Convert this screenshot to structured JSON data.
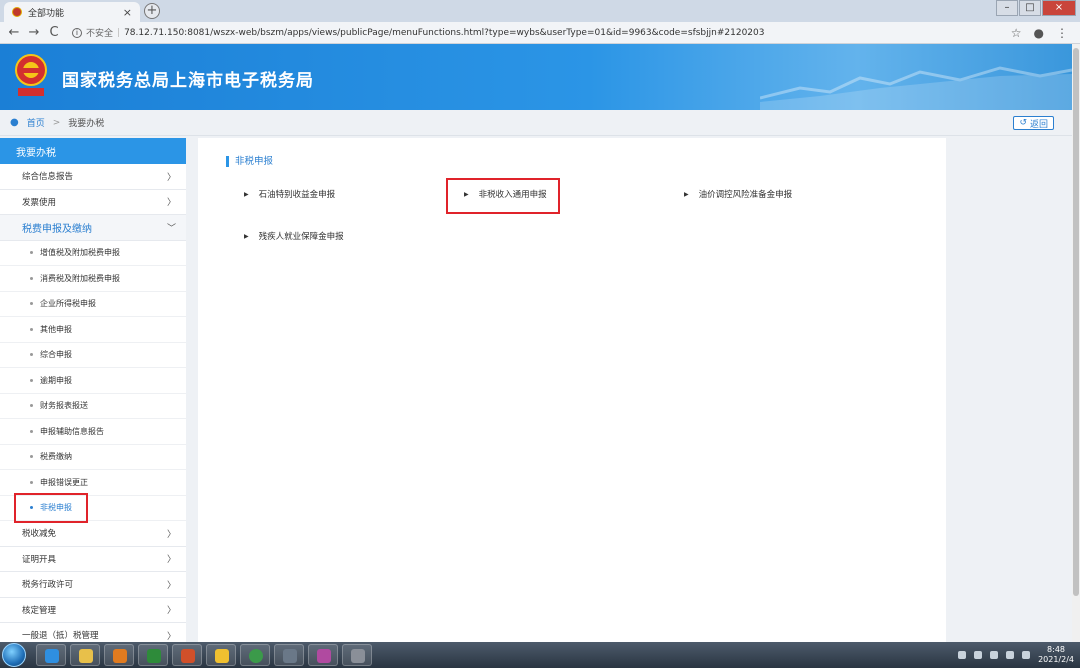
{
  "browser": {
    "tab_title": "全部功能",
    "tab_close": "×",
    "new_tab": "+",
    "insecure_label": "不安全",
    "url": "78.12.71.150:8081/wszx-web/bszm/apps/views/publicPage/menuFunctions.html?type=wybs&userType=01&id=9963&code=sfsbjjn#2120203"
  },
  "header": {
    "site_title": "国家税务总局上海市电子税务局"
  },
  "breadcrumb": {
    "home": "首页",
    "current": "我要办税",
    "back_label": "返回"
  },
  "sidebar": {
    "heading": "我要办税",
    "top_items": [
      {
        "label": "综合信息报告"
      },
      {
        "label": "发票使用"
      }
    ],
    "expanded_item": {
      "label": "税费申报及缴纳"
    },
    "sub_items": [
      {
        "label": "增值税及附加税费申报"
      },
      {
        "label": "消费税及附加税费申报"
      },
      {
        "label": "企业所得税申报"
      },
      {
        "label": "其他申报"
      },
      {
        "label": "综合申报"
      },
      {
        "label": "逾期申报"
      },
      {
        "label": "财务报表报送"
      },
      {
        "label": "申报辅助信息报告"
      },
      {
        "label": "税费缴纳"
      },
      {
        "label": "申报错误更正"
      },
      {
        "label": "非税申报"
      }
    ],
    "bottom_items": [
      {
        "label": "税收减免"
      },
      {
        "label": "证明开具"
      },
      {
        "label": "税务行政许可"
      },
      {
        "label": "核定管理"
      },
      {
        "label": "一般退（抵）税管理"
      }
    ]
  },
  "panel": {
    "title": "非税申报",
    "functions": [
      {
        "label": "石油特别收益金申报"
      },
      {
        "label": "非税收入通用申报"
      },
      {
        "label": "油价调控风险准备金申报"
      },
      {
        "label": "残疾人就业保障金申报"
      }
    ]
  },
  "taskbar": {
    "time": "8:48",
    "date": "2021/2/4"
  },
  "colors": {
    "accent": "#2b95e6",
    "highlight": "#e0232a"
  }
}
